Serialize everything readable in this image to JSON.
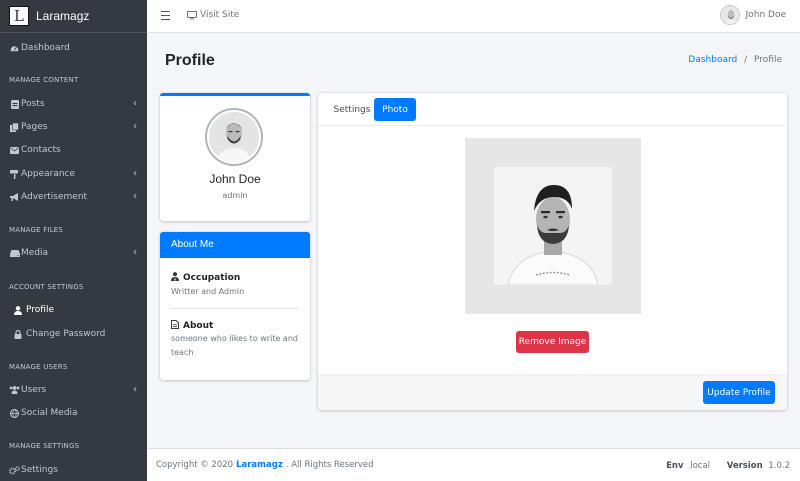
{
  "brand": {
    "logo_letter": "L",
    "name": "Laramagz"
  },
  "topbar": {
    "visit_label": "Visit Site",
    "user_name": "John Doe"
  },
  "sidebar": {
    "dashboard": "Dashboard",
    "headers": {
      "content": "MANAGE CONTENT",
      "files": "MANAGE FILES",
      "account": "ACCOUNT SETTINGS",
      "users": "MANAGE USERS",
      "settings": "MANAGE SETTINGS"
    },
    "items": {
      "posts": "Posts",
      "pages": "Pages",
      "contacts": "Contacts",
      "appearance": "Appearance",
      "advertisement": "Advertisement",
      "media": "Media",
      "profile": "Profile",
      "change_password": "Change Password",
      "users": "Users",
      "social_media": "Social Media",
      "settings": "Settings"
    }
  },
  "page": {
    "title": "Profile",
    "breadcrumb": {
      "home": "Dashboard",
      "sep": "/",
      "current": "Profile"
    }
  },
  "profile": {
    "name": "John Doe",
    "role": "admin"
  },
  "about": {
    "title": "About Me",
    "occupation_label": "Occupation",
    "occupation_value": "Writter and Admin",
    "about_label": "About",
    "about_value": "someone who likes to write and teach"
  },
  "tabs": {
    "settings": "Settings",
    "photo": "Photo"
  },
  "buttons": {
    "remove_image": "Remove Image",
    "update_profile": "Update Profile"
  },
  "footer": {
    "copyright_prefix": "Copyright © 2020",
    "brand": "Laramagz",
    "copyright_suffix": ". All Rights Reserved",
    "env_label": "Env",
    "env_value": "local",
    "version_label": "Version",
    "version_value": "1.0.2"
  },
  "colors": {
    "primary": "#007bff",
    "danger": "#dc3545",
    "sidebar": "#343a40"
  }
}
